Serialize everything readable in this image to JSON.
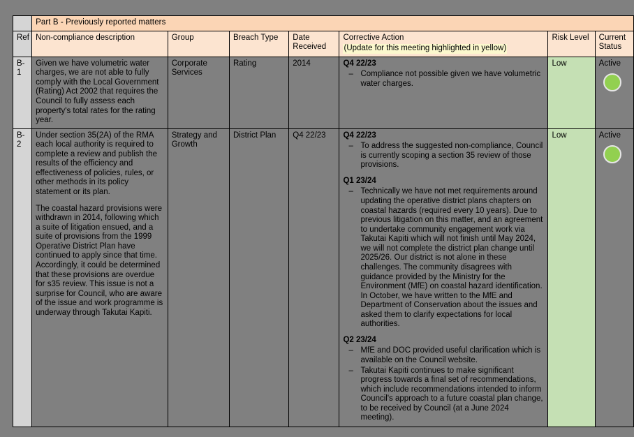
{
  "document": {
    "title": "Part B - Previously reported matters"
  },
  "table": {
    "columns": [
      {
        "key": "ref",
        "label": "Ref"
      },
      {
        "key": "description",
        "label": "Non-compliance description"
      },
      {
        "key": "group",
        "label": "Group"
      },
      {
        "key": "breach_type",
        "label": "Breach Type"
      },
      {
        "key": "date_received",
        "label": "Date Received"
      },
      {
        "key": "corrective_action",
        "label": "Corrective Action",
        "sublabel": "(Update for this meeting highlighted in yellow)"
      },
      {
        "key": "risk_level",
        "label": "Risk Level"
      },
      {
        "key": "current_status",
        "label": "Current Status"
      }
    ],
    "rows": [
      {
        "ref": "B-1",
        "description_paras": [
          "Given we have volumetric water charges, we are not able to fully comply with the Local Government (Rating) Act 2002 that requires the Council to fully assess each property's total rates for the rating year."
        ],
        "group": "Corporate Services",
        "breach_type": "Rating",
        "date_received": "2014",
        "corrective_action": [
          {
            "period": "Q4 22/23",
            "items": [
              "Compliance not possible given we have volumetric water charges."
            ]
          }
        ],
        "risk_level": "Low",
        "current_status": "Active",
        "status_color": "#92d050"
      },
      {
        "ref": "B-2",
        "description_paras": [
          "Under section 35(2A) of the RMA each local authority is required to complete a review and publish the results of the efficiency and effectiveness of policies, rules, or other methods in its policy statement or its plan.",
          "The coastal hazard provisions were withdrawn in 2014, following which a suite of litigation ensued, and a suite of provisions from the 1999 Operative District Plan have continued to apply since that time. Accordingly, it could be determined that these provisions are overdue for s35 review. This issue is not a surprise for Council, who are aware of the issue and work programme is underway through Takutai Kapiti."
        ],
        "group": "Strategy and Growth",
        "breach_type": "District Plan",
        "date_received": "Q4 22/23",
        "corrective_action": [
          {
            "period": "Q4 22/23",
            "items": [
              "To address the suggested non-compliance, Council is currently scoping a section 35 review of those provisions."
            ]
          },
          {
            "period": "Q1 23/24",
            "items": [
              "Technically we have not met requirements around updating the operative district plans chapters on coastal hazards (required every 10 years). Due to previous litigation on this matter, and an agreement to undertake community engagement work via Takutai Kapiti which will not finish until May 2024, we will not complete the district plan change until 2025/26. Our district is not alone in these challenges. The community disagrees with guidance provided by the Ministry for the Environment (MfE) on coastal hazard identification.  In October, we have written to the MfE and Department of Conservation about the issues and asked them to clarify expectations for local authorities."
            ]
          },
          {
            "period": "Q2 23/24",
            "items": [
              "MfE and DOC provided useful clarification which is available on the Council website.",
              "Takutai Kapiti continues to make significant progress towards a final set of recommendations, which include recommendations intended to inform Council's approach to a future coastal plan change, to be received by Council (at a June 2024 meeting)."
            ]
          }
        ],
        "risk_level": "Low",
        "current_status": "Active",
        "status_color": "#92d050"
      }
    ]
  },
  "colors": {
    "title_band": "#fbd5b5",
    "header_band": "#fce4d0",
    "highlight_yellow": "#fbf8cd",
    "risk_low": "#c5e0b4",
    "selection_gray": "#808080",
    "ref_gray": "#d5d5d5"
  }
}
